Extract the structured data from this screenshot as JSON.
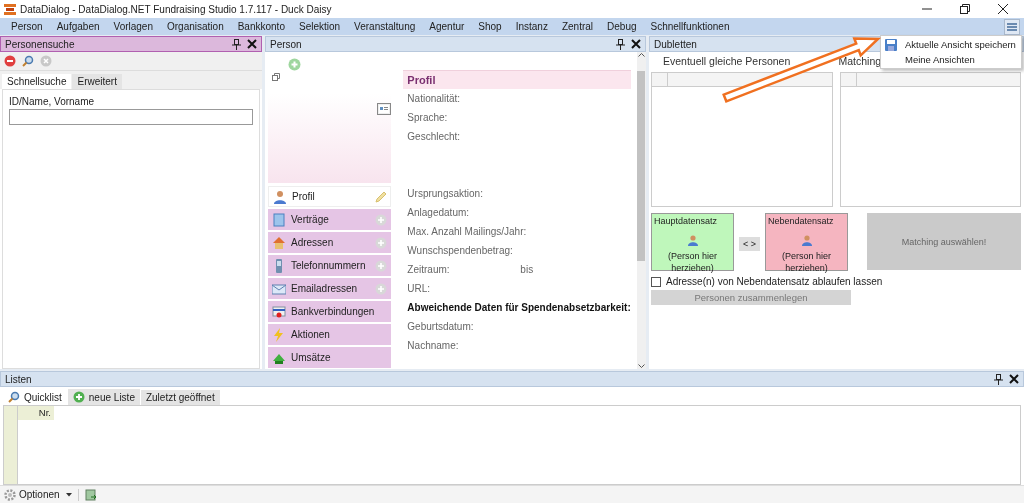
{
  "window": {
    "title": "DataDialog - DataDialog.NET Fundraising Studio 1.7.117 - Duck Daisy"
  },
  "menu": [
    "Person",
    "Aufgaben",
    "Vorlagen",
    "Organisation",
    "Bankkonto",
    "Selektion",
    "Veranstaltung",
    "Agentur",
    "Shop",
    "Instanz",
    "Zentral",
    "Debug",
    "Schnellfunktionen"
  ],
  "search_pane": {
    "title": "Personensuche",
    "active": true,
    "tabs": [
      {
        "label": "Schnellsuche",
        "selected": true
      },
      {
        "label": "Erweitert",
        "selected": false
      }
    ],
    "field_label": "ID/Name, Vorname"
  },
  "person_pane": {
    "title": "Person",
    "active": false,
    "nav": [
      {
        "label": "Profil",
        "selected": true,
        "kind": "edit"
      },
      {
        "label": "Verträge",
        "selected": false,
        "kind": "add"
      },
      {
        "label": "Adressen",
        "selected": false,
        "kind": "add"
      },
      {
        "label": "Telefonnummern",
        "selected": false,
        "kind": "add"
      },
      {
        "label": "Emailadressen",
        "selected": false,
        "kind": "add"
      },
      {
        "label": "Bankverbindungen",
        "selected": false,
        "kind": "plain"
      },
      {
        "label": "Aktionen",
        "selected": false,
        "kind": "plain"
      },
      {
        "label": "Umsätze",
        "selected": false,
        "kind": "plain"
      }
    ],
    "profile_title": "Profil",
    "top_fields": [
      {
        "kind": "field",
        "label": "Nationalität:"
      },
      {
        "kind": "field",
        "label": "Sprache:"
      },
      {
        "kind": "field",
        "label": "Geschlecht:"
      }
    ],
    "fields": [
      {
        "kind": "field",
        "label": "Ursprungsaktion:"
      },
      {
        "kind": "field",
        "label": "Anlagedatum:"
      },
      {
        "kind": "field",
        "label": "Max. Anzahl Mailings/Jahr:"
      },
      {
        "kind": "field",
        "label": "Wunschspendenbetrag:"
      },
      {
        "kind": "range",
        "label": "Zeitraum:",
        "between": "bis"
      },
      {
        "kind": "field",
        "label": "URL:"
      },
      {
        "kind": "heading",
        "label": "Abweichende Daten für Spendenabsetzbarkeit:"
      },
      {
        "kind": "field",
        "label": "Geburtsdatum:"
      },
      {
        "kind": "field",
        "label": "Nachname:"
      }
    ]
  },
  "dubletten_pane": {
    "title": "Dubletten",
    "active": false,
    "headings": [
      "Eventuell gleiche Personen",
      "Matching"
    ],
    "main_record": {
      "title": "Hauptdatensatz",
      "hint": "(Person hier herziehen)"
    },
    "secondary_record": {
      "title": "Nebendatensatz",
      "hint": "(Person hier herziehen)"
    },
    "swap_button": "< >",
    "matching_button": {
      "label": "Matching auswählen!",
      "disabled": true
    },
    "checkbox": {
      "label": "Adresse(n) von Nebendatensatz ablaufen lassen",
      "checked": false
    },
    "merge_button": {
      "label": "Personen zusammenlegen",
      "disabled": true
    }
  },
  "lists_pane": {
    "title": "Listen",
    "active": false,
    "tabs": [
      {
        "label": "Quicklist",
        "selected": true
      },
      {
        "label": "neue Liste",
        "selected": false
      },
      {
        "label": "Zuletzt geöffnet",
        "selected": false
      }
    ],
    "columns": [
      "Nr."
    ],
    "options_button": "Optionen"
  },
  "popup_menu": {
    "items": [
      "Aktuelle Ansicht speichern",
      "Meine Ansichten"
    ]
  }
}
